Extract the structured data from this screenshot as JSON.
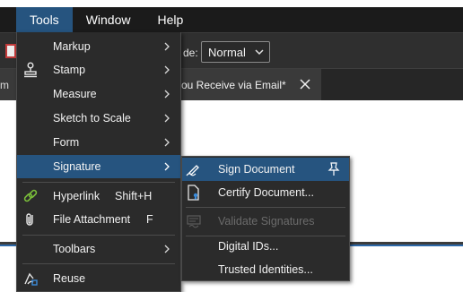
{
  "menubar": {
    "items": [
      {
        "label": "Tools"
      },
      {
        "label": "Window"
      },
      {
        "label": "Help"
      }
    ]
  },
  "toolbar": {
    "mode_label_fragment": "de:",
    "mode_value": "Normal"
  },
  "tabs": {
    "left_fragment": "m",
    "active_label": "ou Receive via Email*"
  },
  "tools_menu": {
    "items": [
      {
        "label": "Markup",
        "icon": "none",
        "submenu": true
      },
      {
        "label": "Stamp",
        "icon": "stamp-icon",
        "submenu": true
      },
      {
        "label": "Measure",
        "icon": "none",
        "submenu": true
      },
      {
        "label": "Sketch to Scale",
        "icon": "none",
        "submenu": true
      },
      {
        "label": "Form",
        "icon": "none",
        "submenu": true
      },
      {
        "label": "Signature",
        "icon": "none",
        "submenu": true,
        "highlighted": true
      },
      {
        "label": "Hyperlink",
        "shortcut": "Shift+H",
        "icon": "link-icon"
      },
      {
        "label": "File Attachment",
        "shortcut": "F",
        "icon": "paperclip-icon"
      },
      {
        "label": "Toolbars",
        "icon": "none",
        "submenu": true
      },
      {
        "label": "Reuse",
        "icon": "reuse-icon"
      }
    ]
  },
  "signature_submenu": {
    "items": [
      {
        "label": "Sign Document",
        "icon": "sign-pen-icon",
        "highlighted": true
      },
      {
        "label": "Certify Document...",
        "icon": "certify-document-icon"
      },
      {
        "label": "Validate Signatures",
        "icon": "validate-signatures-icon",
        "disabled": true
      },
      {
        "label": "Digital IDs...",
        "icon": "none"
      },
      {
        "label": "Trusted Identities...",
        "icon": "none"
      }
    ]
  },
  "colors": {
    "menubar_bg": "#1b1b1b",
    "menu_bg": "#2b2b2b",
    "highlight": "#26547f",
    "link_green": "#7bbf3a",
    "accent_blue": "#2d68a8"
  }
}
